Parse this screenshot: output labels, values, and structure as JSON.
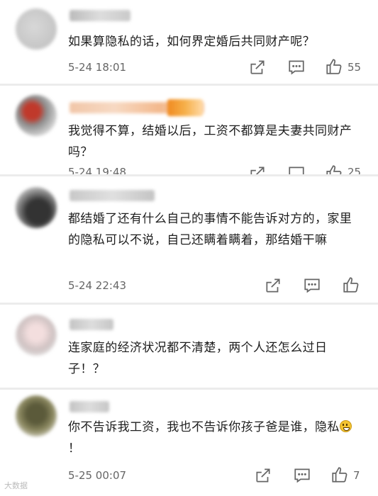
{
  "comments": [
    {
      "text": "如果算隐私的话，如何界定婚后共同财产呢？",
      "time": "5-24 18:01",
      "likes": "55"
    },
    {
      "text": "我觉得不算，结婚以后，工资不都算是夫妻共同财产吗？",
      "time": "5-24 19:48",
      "likes": "25"
    },
    {
      "text": "都结婚了还有什么自己的事情不能告诉对方的，家里的隐私可以不说，自己还瞒着瞒着，那结婚干嘛",
      "time": "5-24 22:43",
      "likes": ""
    },
    {
      "text": "连家庭的经济状况都不清楚，两个人还怎么过日子！？",
      "time": "",
      "likes": ""
    },
    {
      "text_before_emoji": "你不告诉我工资，我也不告诉你孩子爸是谁，隐私",
      "text_after_emoji": "！",
      "time": "5-25 00:07",
      "likes": "7"
    }
  ],
  "icons": {
    "share": "share-icon",
    "comment": "comment-icon",
    "like": "thumbs-up-icon",
    "emoji": "grinning-face-emoji"
  },
  "watermark": "大数据"
}
